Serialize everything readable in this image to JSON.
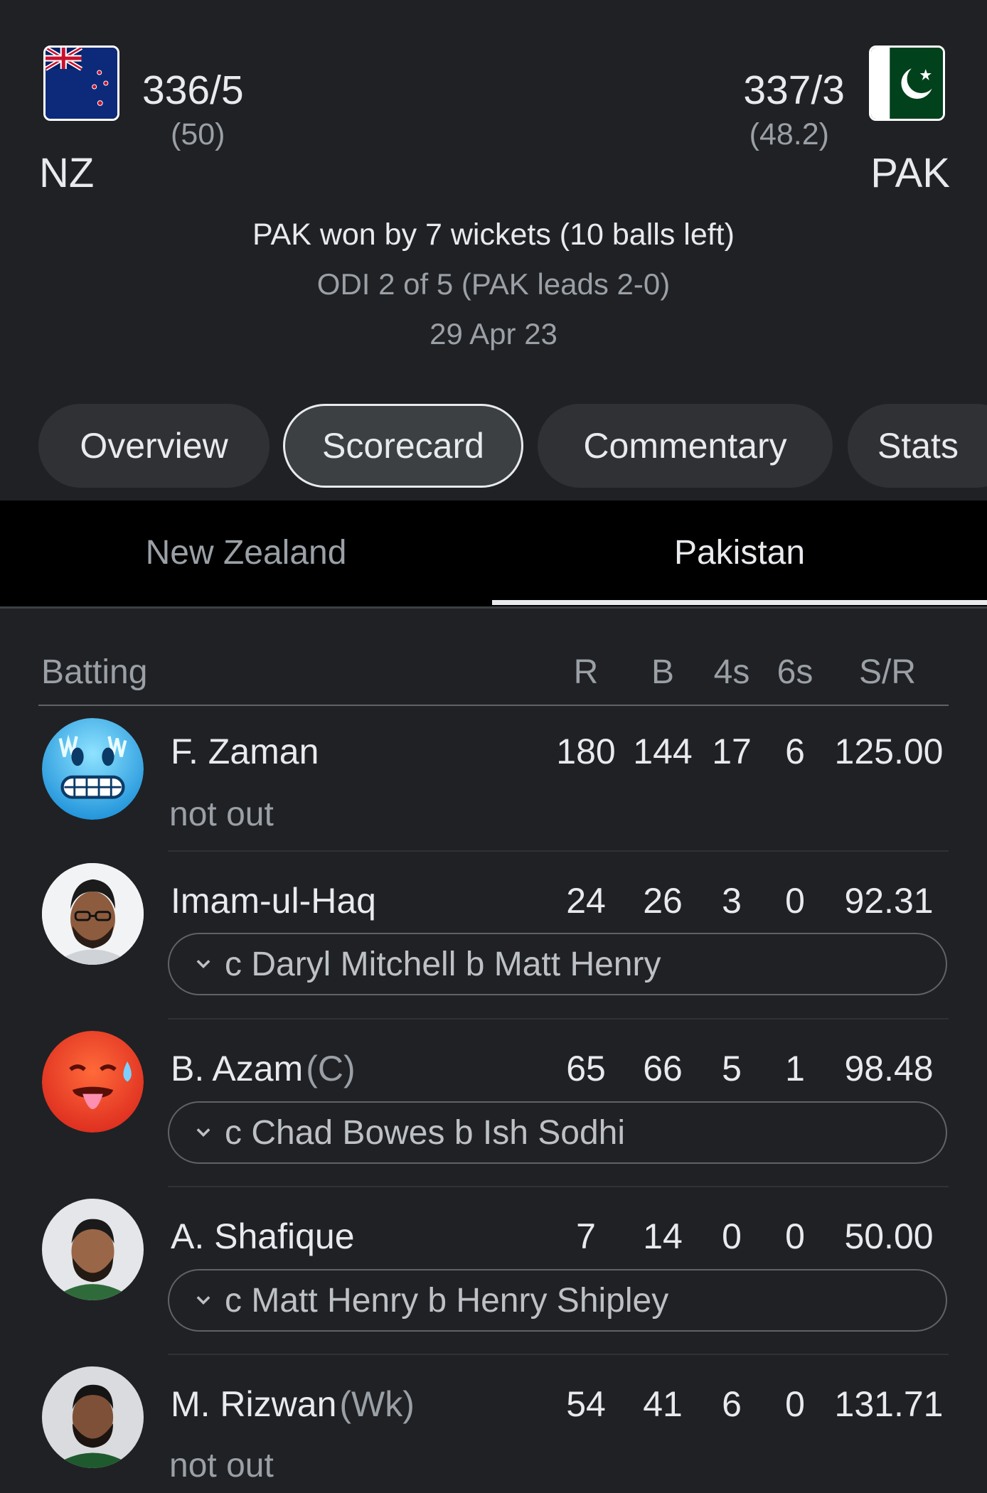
{
  "match": {
    "home": {
      "abbr": "NZ",
      "score": "336/5",
      "overs": "(50)",
      "flag": "new-zealand-flag"
    },
    "away": {
      "abbr": "PAK",
      "score": "337/3",
      "overs": "(48.2)",
      "flag": "pakistan-flag"
    },
    "result": "PAK won by 7 wickets (10 balls left)",
    "series": "ODI 2 of 5 (PAK leads 2-0)",
    "date": "29 Apr 23"
  },
  "tabs": [
    "Overview",
    "Scorecard",
    "Commentary",
    "Stats"
  ],
  "active_tab": "Scorecard",
  "team_tabs": [
    "New Zealand",
    "Pakistan"
  ],
  "active_team_tab": "Pakistan",
  "batting": {
    "title": "Batting",
    "columns": [
      "R",
      "B",
      "4s",
      "6s",
      "S/R"
    ],
    "players": [
      {
        "name": "F. Zaman",
        "role": "",
        "avatar": "freezing-face-emoji",
        "R": "180",
        "B": "144",
        "4s": "17",
        "6s": "6",
        "SR": "125.00",
        "status": "not out",
        "dismissal": ""
      },
      {
        "name": "Imam-ul-Haq",
        "role": "",
        "avatar": "player-photo-avatar",
        "R": "24",
        "B": "26",
        "4s": "3",
        "6s": "0",
        "SR": "92.31",
        "status": "",
        "dismissal": "c Daryl Mitchell b Matt Henry"
      },
      {
        "name": "B. Azam",
        "role": "(C)",
        "avatar": "hot-face-emoji",
        "R": "65",
        "B": "66",
        "4s": "5",
        "6s": "1",
        "SR": "98.48",
        "status": "",
        "dismissal": "c Chad Bowes b Ish Sodhi"
      },
      {
        "name": "A. Shafique",
        "role": "",
        "avatar": "player-photo-avatar",
        "R": "7",
        "B": "14",
        "4s": "0",
        "6s": "0",
        "SR": "50.00",
        "status": "",
        "dismissal": "c Matt Henry b Henry Shipley"
      },
      {
        "name": "M. Rizwan",
        "role": "(Wk)",
        "avatar": "player-photo-avatar",
        "R": "54",
        "B": "41",
        "4s": "6",
        "6s": "0",
        "SR": "131.71",
        "status": "not out",
        "dismissal": ""
      }
    ]
  }
}
